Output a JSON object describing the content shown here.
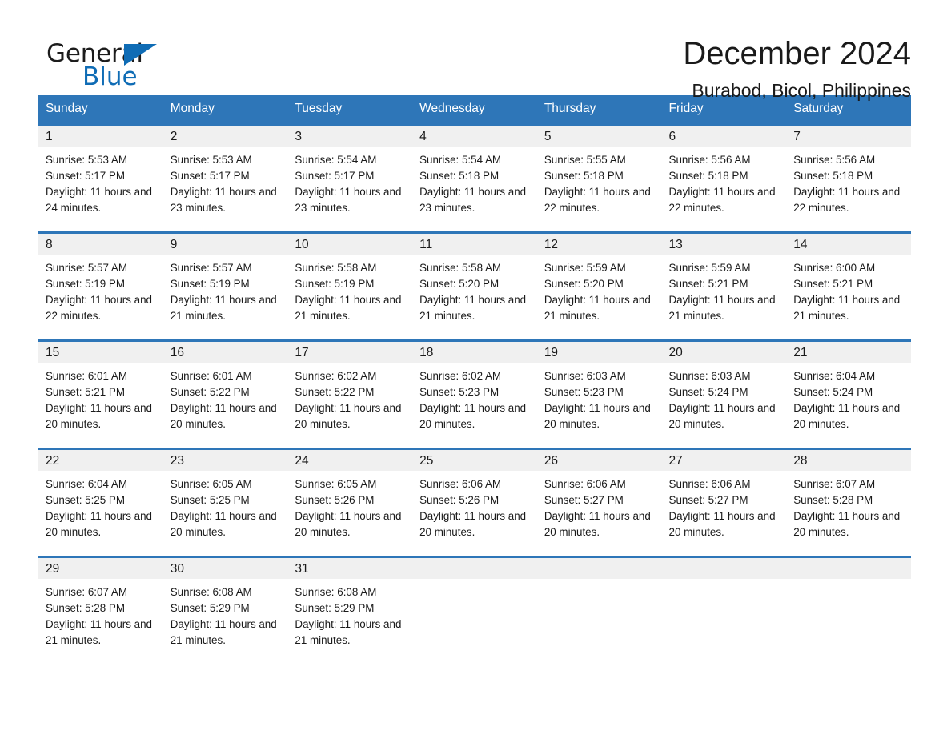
{
  "brand": {
    "name_part1": "General",
    "name_part2": "Blue",
    "triangle_icon": "triangle-icon",
    "accent_color": "#0f6cb5"
  },
  "header": {
    "title": "December 2024",
    "subtitle": "Burabod, Bicol, Philippines"
  },
  "theme": {
    "header_blue": "#2e76b8",
    "daynum_gray": "#f0f0f0",
    "text": "#1a1a1a"
  },
  "calendar": {
    "weekday_headers": [
      "Sunday",
      "Monday",
      "Tuesday",
      "Wednesday",
      "Thursday",
      "Friday",
      "Saturday"
    ],
    "weeks": [
      [
        {
          "day": "1",
          "sunrise": "Sunrise: 5:53 AM",
          "sunset": "Sunset: 5:17 PM",
          "daylight": "Daylight: 11 hours and 24 minutes."
        },
        {
          "day": "2",
          "sunrise": "Sunrise: 5:53 AM",
          "sunset": "Sunset: 5:17 PM",
          "daylight": "Daylight: 11 hours and 23 minutes."
        },
        {
          "day": "3",
          "sunrise": "Sunrise: 5:54 AM",
          "sunset": "Sunset: 5:17 PM",
          "daylight": "Daylight: 11 hours and 23 minutes."
        },
        {
          "day": "4",
          "sunrise": "Sunrise: 5:54 AM",
          "sunset": "Sunset: 5:18 PM",
          "daylight": "Daylight: 11 hours and 23 minutes."
        },
        {
          "day": "5",
          "sunrise": "Sunrise: 5:55 AM",
          "sunset": "Sunset: 5:18 PM",
          "daylight": "Daylight: 11 hours and 22 minutes."
        },
        {
          "day": "6",
          "sunrise": "Sunrise: 5:56 AM",
          "sunset": "Sunset: 5:18 PM",
          "daylight": "Daylight: 11 hours and 22 minutes."
        },
        {
          "day": "7",
          "sunrise": "Sunrise: 5:56 AM",
          "sunset": "Sunset: 5:18 PM",
          "daylight": "Daylight: 11 hours and 22 minutes."
        }
      ],
      [
        {
          "day": "8",
          "sunrise": "Sunrise: 5:57 AM",
          "sunset": "Sunset: 5:19 PM",
          "daylight": "Daylight: 11 hours and 22 minutes."
        },
        {
          "day": "9",
          "sunrise": "Sunrise: 5:57 AM",
          "sunset": "Sunset: 5:19 PM",
          "daylight": "Daylight: 11 hours and 21 minutes."
        },
        {
          "day": "10",
          "sunrise": "Sunrise: 5:58 AM",
          "sunset": "Sunset: 5:19 PM",
          "daylight": "Daylight: 11 hours and 21 minutes."
        },
        {
          "day": "11",
          "sunrise": "Sunrise: 5:58 AM",
          "sunset": "Sunset: 5:20 PM",
          "daylight": "Daylight: 11 hours and 21 minutes."
        },
        {
          "day": "12",
          "sunrise": "Sunrise: 5:59 AM",
          "sunset": "Sunset: 5:20 PM",
          "daylight": "Daylight: 11 hours and 21 minutes."
        },
        {
          "day": "13",
          "sunrise": "Sunrise: 5:59 AM",
          "sunset": "Sunset: 5:21 PM",
          "daylight": "Daylight: 11 hours and 21 minutes."
        },
        {
          "day": "14",
          "sunrise": "Sunrise: 6:00 AM",
          "sunset": "Sunset: 5:21 PM",
          "daylight": "Daylight: 11 hours and 21 minutes."
        }
      ],
      [
        {
          "day": "15",
          "sunrise": "Sunrise: 6:01 AM",
          "sunset": "Sunset: 5:21 PM",
          "daylight": "Daylight: 11 hours and 20 minutes."
        },
        {
          "day": "16",
          "sunrise": "Sunrise: 6:01 AM",
          "sunset": "Sunset: 5:22 PM",
          "daylight": "Daylight: 11 hours and 20 minutes."
        },
        {
          "day": "17",
          "sunrise": "Sunrise: 6:02 AM",
          "sunset": "Sunset: 5:22 PM",
          "daylight": "Daylight: 11 hours and 20 minutes."
        },
        {
          "day": "18",
          "sunrise": "Sunrise: 6:02 AM",
          "sunset": "Sunset: 5:23 PM",
          "daylight": "Daylight: 11 hours and 20 minutes."
        },
        {
          "day": "19",
          "sunrise": "Sunrise: 6:03 AM",
          "sunset": "Sunset: 5:23 PM",
          "daylight": "Daylight: 11 hours and 20 minutes."
        },
        {
          "day": "20",
          "sunrise": "Sunrise: 6:03 AM",
          "sunset": "Sunset: 5:24 PM",
          "daylight": "Daylight: 11 hours and 20 minutes."
        },
        {
          "day": "21",
          "sunrise": "Sunrise: 6:04 AM",
          "sunset": "Sunset: 5:24 PM",
          "daylight": "Daylight: 11 hours and 20 minutes."
        }
      ],
      [
        {
          "day": "22",
          "sunrise": "Sunrise: 6:04 AM",
          "sunset": "Sunset: 5:25 PM",
          "daylight": "Daylight: 11 hours and 20 minutes."
        },
        {
          "day": "23",
          "sunrise": "Sunrise: 6:05 AM",
          "sunset": "Sunset: 5:25 PM",
          "daylight": "Daylight: 11 hours and 20 minutes."
        },
        {
          "day": "24",
          "sunrise": "Sunrise: 6:05 AM",
          "sunset": "Sunset: 5:26 PM",
          "daylight": "Daylight: 11 hours and 20 minutes."
        },
        {
          "day": "25",
          "sunrise": "Sunrise: 6:06 AM",
          "sunset": "Sunset: 5:26 PM",
          "daylight": "Daylight: 11 hours and 20 minutes."
        },
        {
          "day": "26",
          "sunrise": "Sunrise: 6:06 AM",
          "sunset": "Sunset: 5:27 PM",
          "daylight": "Daylight: 11 hours and 20 minutes."
        },
        {
          "day": "27",
          "sunrise": "Sunrise: 6:06 AM",
          "sunset": "Sunset: 5:27 PM",
          "daylight": "Daylight: 11 hours and 20 minutes."
        },
        {
          "day": "28",
          "sunrise": "Sunrise: 6:07 AM",
          "sunset": "Sunset: 5:28 PM",
          "daylight": "Daylight: 11 hours and 20 minutes."
        }
      ],
      [
        {
          "day": "29",
          "sunrise": "Sunrise: 6:07 AM",
          "sunset": "Sunset: 5:28 PM",
          "daylight": "Daylight: 11 hours and 21 minutes."
        },
        {
          "day": "30",
          "sunrise": "Sunrise: 6:08 AM",
          "sunset": "Sunset: 5:29 PM",
          "daylight": "Daylight: 11 hours and 21 minutes."
        },
        {
          "day": "31",
          "sunrise": "Sunrise: 6:08 AM",
          "sunset": "Sunset: 5:29 PM",
          "daylight": "Daylight: 11 hours and 21 minutes."
        },
        {
          "day": "",
          "sunrise": "",
          "sunset": "",
          "daylight": ""
        },
        {
          "day": "",
          "sunrise": "",
          "sunset": "",
          "daylight": ""
        },
        {
          "day": "",
          "sunrise": "",
          "sunset": "",
          "daylight": ""
        },
        {
          "day": "",
          "sunrise": "",
          "sunset": "",
          "daylight": ""
        }
      ]
    ]
  }
}
